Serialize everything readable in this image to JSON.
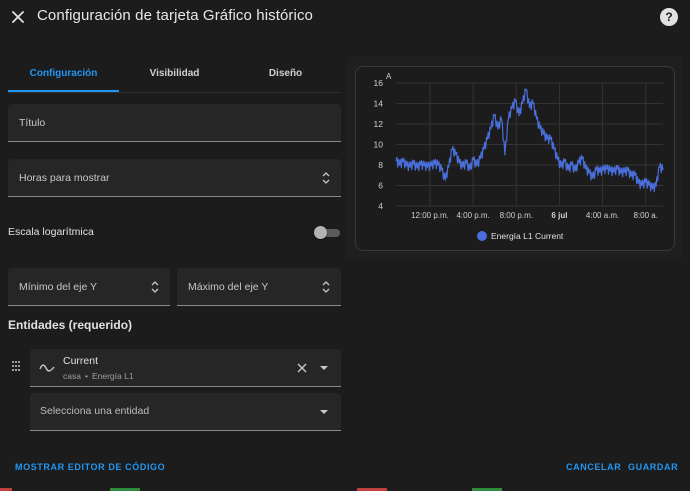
{
  "dialog": {
    "title": "Configuración de tarjeta Gráfico histórico",
    "close_icon": "close-icon",
    "help_icon": "help-icon",
    "help_glyph": "?"
  },
  "tabs": [
    {
      "label": "Configuración",
      "active": true
    },
    {
      "label": "Visibilidad",
      "active": false
    },
    {
      "label": "Diseño",
      "active": false
    }
  ],
  "form": {
    "title_label": "Título",
    "hours_label": "Horas para mostrar",
    "log_scale_label": "Escala logarítmica",
    "log_scale_on": false,
    "y_min_label": "Mínimo del eje Y",
    "y_max_label": "Máximo del eje Y"
  },
  "entities": {
    "section_title": "Entidades (requerido)",
    "items": [
      {
        "name": "Current",
        "area": "casa",
        "separator": "•",
        "device": "Energía L1",
        "icon": "sine-wave-icon"
      }
    ],
    "select_placeholder": "Selecciona una entidad"
  },
  "footer": {
    "show_code_label": "MOSTRAR EDITOR DE CÓDIGO",
    "cancel_label": "CANCELAR",
    "save_label": "GUARDAR"
  },
  "colors": {
    "accent": "#2196f3",
    "series": "#4a6fdc",
    "background": "#1c1c1c"
  },
  "chart_data": {
    "type": "line",
    "title": "",
    "xlabel": "",
    "ylabel": "A",
    "ylim": [
      4,
      16
    ],
    "yticks": [
      4,
      6,
      8,
      10,
      12,
      14,
      16
    ],
    "xticks": [
      {
        "label": "12:00 p.m.",
        "bold": false
      },
      {
        "label": "4:00 p.m.",
        "bold": false
      },
      {
        "label": "8:00 p.m.",
        "bold": false
      },
      {
        "label": "6 jul",
        "bold": true
      },
      {
        "label": "4:00 a.m.",
        "bold": false
      },
      {
        "label": "8:00 a.",
        "bold": false
      }
    ],
    "grid": true,
    "legend_position": "bottom-center",
    "series": [
      {
        "name": "Energía L1 Current",
        "x_hours": [
          0,
          0.5,
          1,
          1.5,
          2,
          2.5,
          3,
          3.5,
          4,
          4.5,
          5,
          5.5,
          6,
          6.5,
          7,
          7.5,
          8,
          8.5,
          9,
          9.5,
          10,
          10.5,
          11,
          11.5,
          12,
          12.5,
          13,
          13.5,
          14,
          14.5,
          15,
          15.5,
          16,
          16.5,
          17,
          17.5,
          18,
          18.5,
          19,
          19.5,
          20,
          20.5,
          21,
          21.5,
          22,
          22.5,
          23,
          23.5,
          24,
          24.5,
          25,
          25.5,
          26,
          26.5,
          27,
          27.5,
          28,
          28.5,
          29,
          29.5,
          30,
          30.5,
          31,
          31.5,
          32,
          32.5,
          33,
          33.5,
          34,
          34.5,
          35,
          35.5,
          36,
          36.5,
          37,
          37.5,
          38
        ],
        "values": [
          8.4,
          8.0,
          8.3,
          7.9,
          7.8,
          8.1,
          7.7,
          8.0,
          7.9,
          7.8,
          7.9,
          8.1,
          8.0,
          7.5,
          6.5,
          7.8,
          9.5,
          9.0,
          8.2,
          7.8,
          8.2,
          7.5,
          8.5,
          7.9,
          8.6,
          9.5,
          10.5,
          11.5,
          12.8,
          11.5,
          12.5,
          9.0,
          12.5,
          13.5,
          14.2,
          12.8,
          14.0,
          15.3,
          13.6,
          14.0,
          12.5,
          11.5,
          11.0,
          10.5,
          10.5,
          9.5,
          8.5,
          7.8,
          8.3,
          7.5,
          8.0,
          7.4,
          8.2,
          8.6,
          7.6,
          7.2,
          6.7,
          7.5,
          7.3,
          7.5,
          7.6,
          7.4,
          7.3,
          7.6,
          7.2,
          7.3,
          7.4,
          6.9,
          7.0,
          6.2,
          6.0,
          6.3,
          6.0,
          5.7,
          5.9,
          7.8,
          7.5
        ],
        "color": "#4a6fdc"
      }
    ]
  }
}
